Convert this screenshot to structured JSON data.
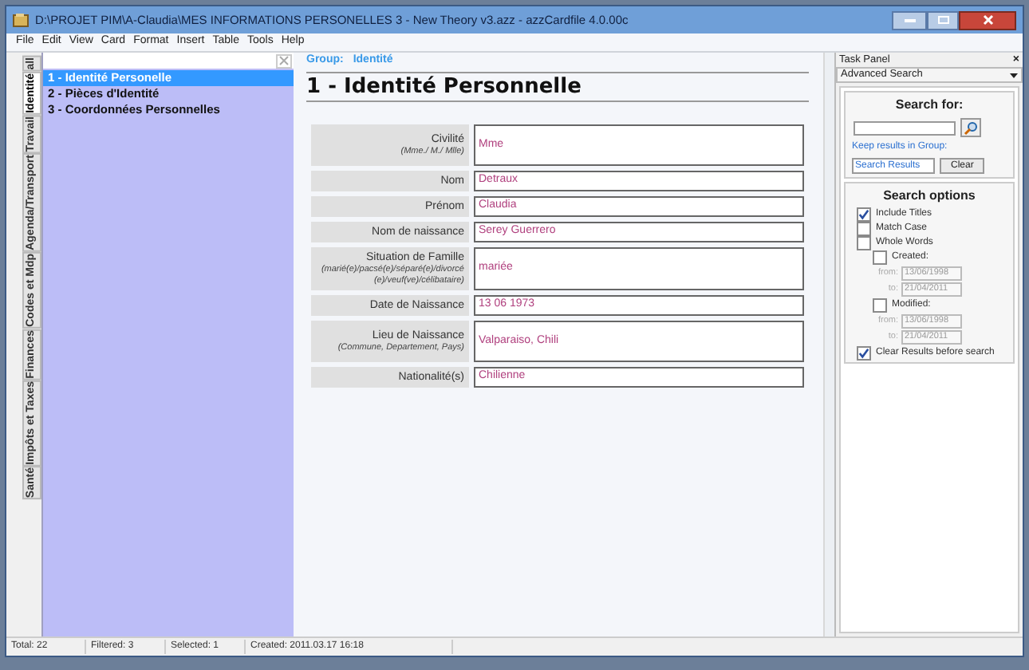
{
  "window": {
    "title": "D:\\PROJET PIM\\A-Claudia\\MES INFORMATIONS PERSONELLES 3 - New Theory v3.azz - azzCardfile 4.0.00c"
  },
  "menu": [
    "File",
    "Edit",
    "View",
    "Card",
    "Format",
    "Insert",
    "Table",
    "Tools",
    "Help"
  ],
  "side_tabs": [
    {
      "label": "all",
      "selected": false
    },
    {
      "label": "Identité",
      "selected": true
    },
    {
      "label": "Travail",
      "selected": false
    },
    {
      "label": "Agenda/Transport",
      "selected": false
    },
    {
      "label": "Codes et Mdp",
      "selected": false
    },
    {
      "label": "Finances",
      "selected": false
    },
    {
      "label": "Impôts et Taxes",
      "selected": false
    },
    {
      "label": "Santé",
      "selected": false
    }
  ],
  "cards": [
    {
      "label": "1 - Identité Personelle",
      "selected": true
    },
    {
      "label": "2 - Pièces d'Identité",
      "selected": false
    },
    {
      "label": "3 - Coordonnées Personnelles",
      "selected": false
    }
  ],
  "card": {
    "group_label": "Group:",
    "group": "Identité",
    "title": "1 - Identité Personnelle",
    "fields": [
      {
        "label": "Civilité",
        "hint": "(Mme./ M./ Mlle)",
        "value": "Mme"
      },
      {
        "label": "Nom",
        "value": "Detraux"
      },
      {
        "label": "Prénom",
        "value": "Claudia"
      },
      {
        "label": "Nom de naissance",
        "value": "Serey Guerrero"
      },
      {
        "label": "Situation de Famille",
        "hint": "(marié(e)/pacsé(e)/séparé(e)/divorcé(e)/veuf(ve)/célibataire)",
        "value": "mariée"
      },
      {
        "label": "Date de Naissance",
        "value": "13 06 1973"
      },
      {
        "label": "Lieu de Naissance",
        "hint": "(Commune, Departement, Pays)",
        "value": "Valparaiso, Chili"
      },
      {
        "label": "Nationalité(s)",
        "value": "Chilienne"
      }
    ]
  },
  "task_panel": {
    "title": "Task Panel",
    "close": "×",
    "dropdown": "Advanced Search",
    "search_heading": "Search for:",
    "keep_label": "Keep results in Group:",
    "group_value": "Search Results",
    "clear": "Clear",
    "options_heading": "Search options",
    "options": [
      {
        "kind": "check",
        "label": "Include Titles",
        "checked": true
      },
      {
        "kind": "check",
        "label": "Match Case",
        "checked": false
      },
      {
        "kind": "check",
        "label": "Whole Words",
        "checked": false
      },
      {
        "kind": "date",
        "label": "Created:",
        "checked": false,
        "from_label": "from:",
        "from": "13/06/1998",
        "to_label": "to:",
        "to": "21/04/2011"
      },
      {
        "kind": "date",
        "label": "Modified:",
        "checked": false,
        "from_label": "from:",
        "from": "13/06/1998",
        "to_label": "to:",
        "to": "21/04/2011"
      },
      {
        "kind": "check",
        "label": "Clear Results before search",
        "checked": true
      }
    ]
  },
  "status_bar": [
    "Total: 22",
    "Filtered: 3",
    "Selected: 1",
    "Created: 2011.03.17 16:18"
  ]
}
